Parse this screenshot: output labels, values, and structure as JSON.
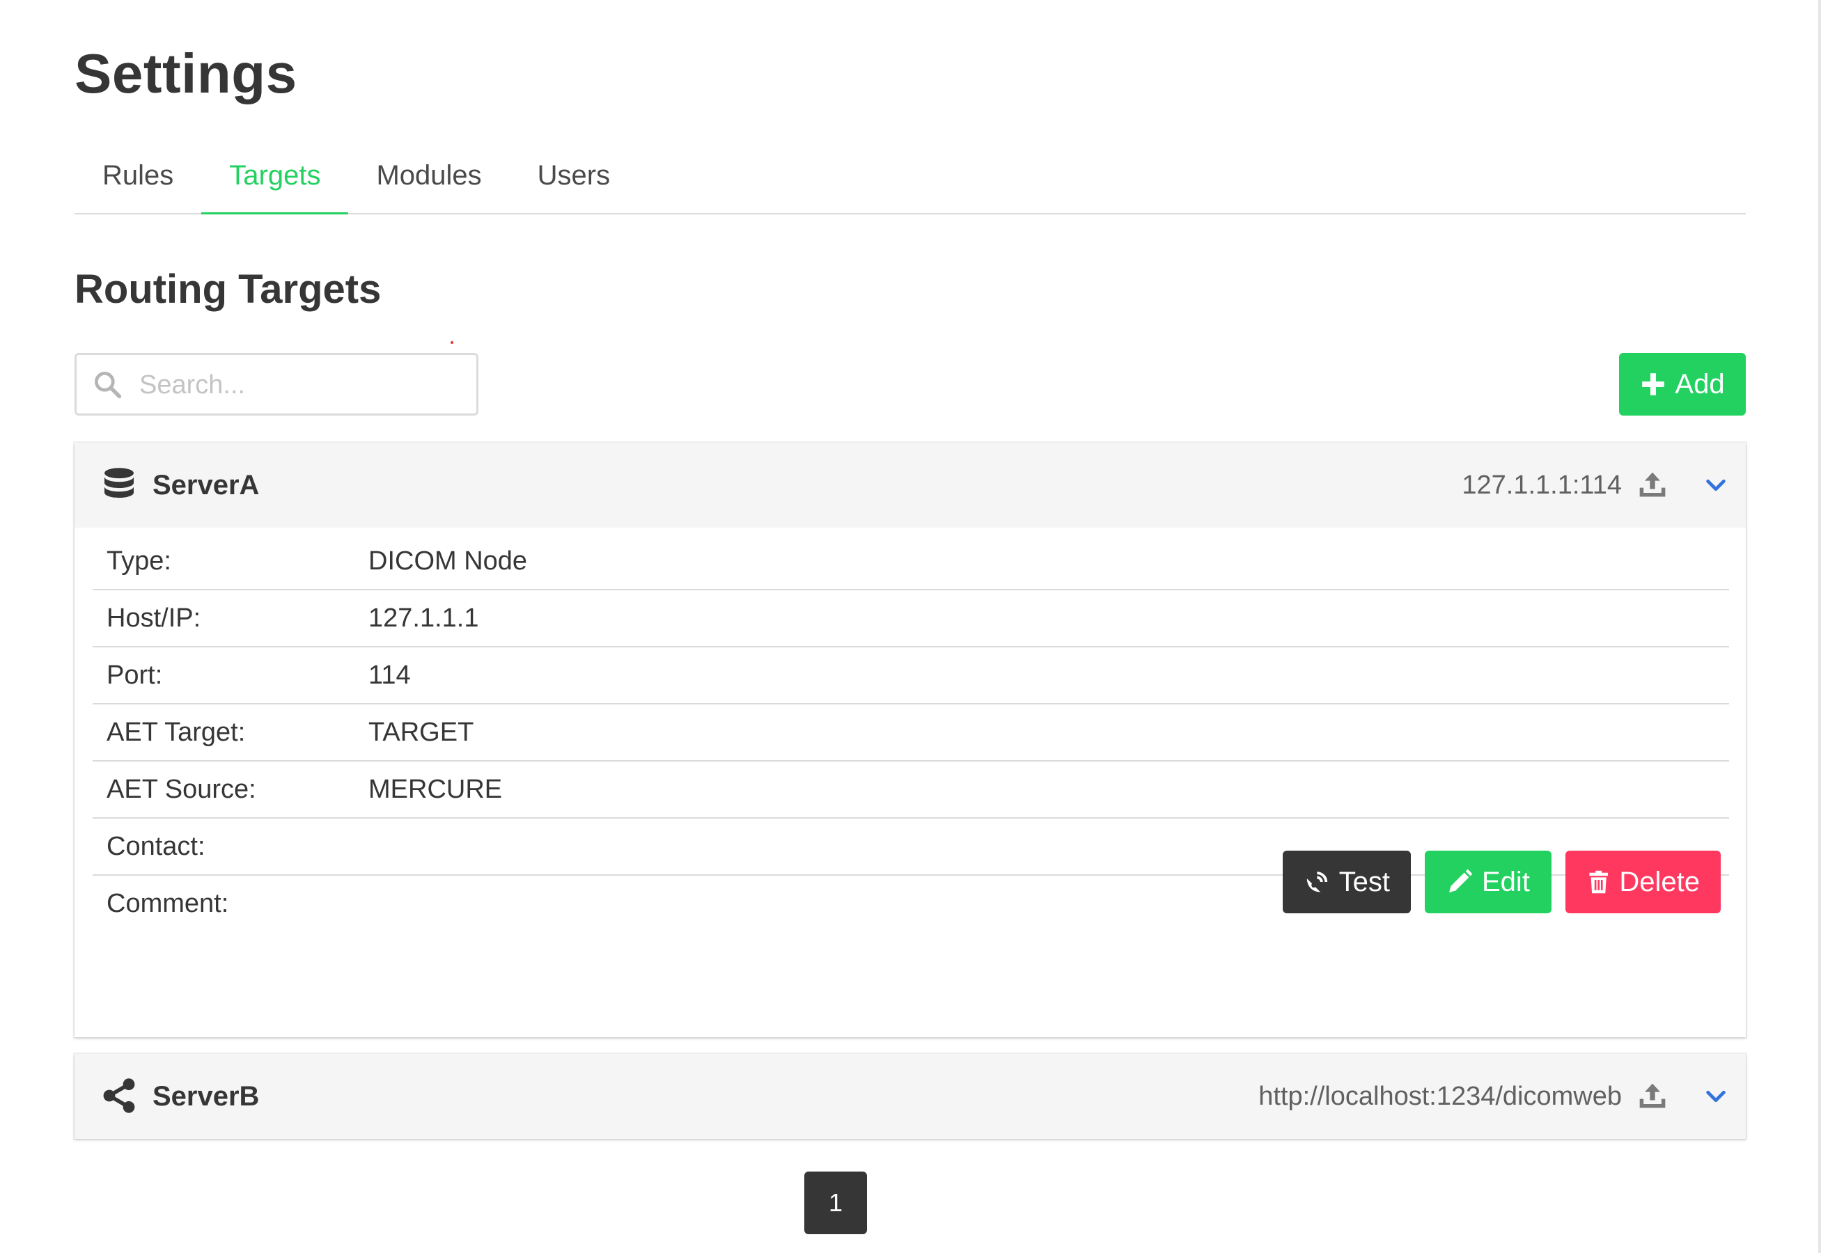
{
  "page": {
    "title": "Settings"
  },
  "tabs": [
    {
      "label": "Rules"
    },
    {
      "label": "Targets"
    },
    {
      "label": "Modules"
    },
    {
      "label": "Users"
    }
  ],
  "section": {
    "title": "Routing Targets"
  },
  "search": {
    "placeholder": "Search..."
  },
  "add_button": {
    "label": "Add"
  },
  "targets": [
    {
      "name": "ServerA",
      "address": "127.1.1.1:114",
      "icon": "database-icon",
      "expanded": true,
      "fields": [
        {
          "label": "Type:",
          "value": "DICOM Node"
        },
        {
          "label": "Host/IP:",
          "value": "127.1.1.1"
        },
        {
          "label": "Port:",
          "value": "114"
        },
        {
          "label": "AET Target:",
          "value": "TARGET"
        },
        {
          "label": "AET Source:",
          "value": "MERCURE"
        },
        {
          "label": "Contact:",
          "value": ""
        },
        {
          "label": "Comment:",
          "value": ""
        }
      ],
      "actions": {
        "test": "Test",
        "edit": "Edit",
        "delete": "Delete"
      }
    },
    {
      "name": "ServerB",
      "address": "http://localhost:1234/dicomweb",
      "icon": "share-icon",
      "expanded": false
    }
  ],
  "pagination": {
    "current": "1"
  },
  "colors": {
    "accent": "#23d160",
    "danger": "#ff3860",
    "dark": "#363636"
  }
}
